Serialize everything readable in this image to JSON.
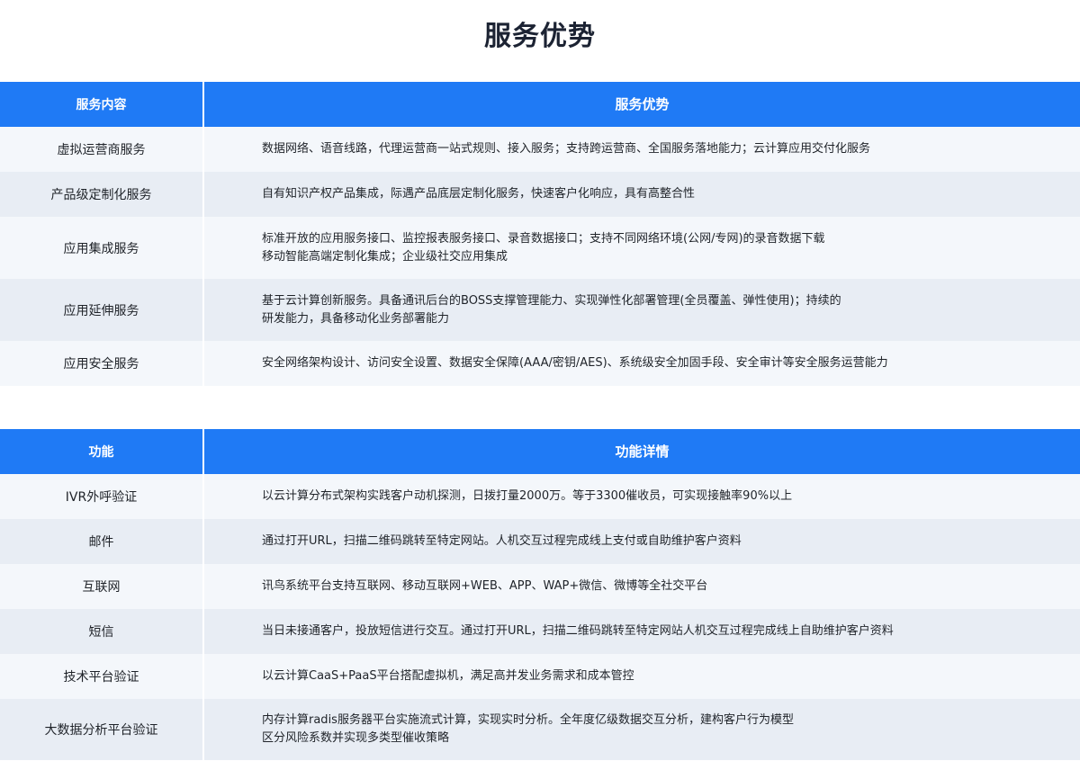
{
  "page": {
    "title": "服务优势"
  },
  "service_table": {
    "headers": {
      "left": "服务内容",
      "right": "服务优势"
    },
    "rows": [
      {
        "name": "虚拟运营商服务",
        "lines": [
          "数据网络、语音线路，代理运营商一站式规则、接入服务；支持跨运营商、全国服务落地能力；云计算应用交付化服务"
        ]
      },
      {
        "name": "产品级定制化服务",
        "lines": [
          "自有知识产权产品集成，际遇产品底层定制化服务，快速客户化响应，具有高整合性"
        ]
      },
      {
        "name": "应用集成服务",
        "lines": [
          "标准开放的应用服务接口、监控报表服务接口、录音数据接口；支持不同网络环境(公网/专网)的录音数据下载",
          "移动智能高端定制化集成；企业级社交应用集成"
        ]
      },
      {
        "name": "应用延伸服务",
        "lines": [
          "基于云计算创新服务。具备通讯后台的BOSS支撑管理能力、实现弹性化部署管理(全员覆盖、弹性使用)；持续的",
          "研发能力，具备移动化业务部署能力"
        ]
      },
      {
        "name": "应用安全服务",
        "lines": [
          "安全网络架构设计、访问安全设置、数据安全保障(AAA/密钥/AES)、系统级安全加固手段、安全审计等安全服务运营能力"
        ]
      }
    ]
  },
  "function_table": {
    "headers": {
      "left": "功能",
      "right": "功能详情"
    },
    "rows": [
      {
        "name": "IVR外呼验证",
        "lines": [
          "以云计算分布式架构实践客户动机探测，日拨打量2000万。等于3300催收员，可实现接触率90%以上"
        ]
      },
      {
        "name": "邮件",
        "lines": [
          "通过打开URL，扫描二维码跳转至特定网站。人机交互过程完成线上支付或自助维护客户资料"
        ]
      },
      {
        "name": "互联网",
        "lines": [
          "讯鸟系统平台支持互联网、移动互联网+WEB、APP、WAP+微信、微博等全社交平台"
        ]
      },
      {
        "name": "短信",
        "lines": [
          "当日未接通客户，投放短信进行交互。通过打开URL，扫描二维码跳转至特定网站人机交互过程完成线上自助维护客户资料"
        ]
      },
      {
        "name": "技术平台验证",
        "lines": [
          "以云计算CaaS+PaaS平台搭配虚拟机，满足高并发业务需求和成本管控"
        ]
      },
      {
        "name": "大数据分析平台验证",
        "lines": [
          "内存计算radis服务器平台实施流式计算，实现实时分析。全年度亿级数据交互分析，建构客户行为模型",
          "区分风险系数并实现多类型催收策略"
        ]
      }
    ]
  }
}
